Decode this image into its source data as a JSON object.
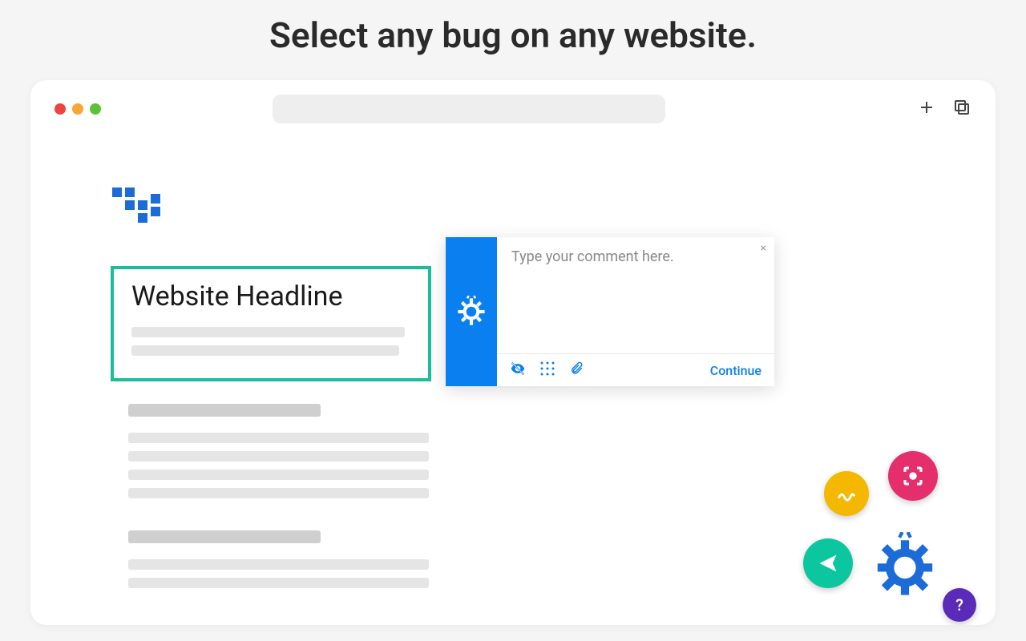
{
  "page": {
    "title": "Select any bug on any website."
  },
  "mockup": {
    "headline": "Website Headline"
  },
  "comment_popup": {
    "placeholder": "Type your comment here.",
    "continue_label": "Continue"
  },
  "colors": {
    "primary_blue": "#0a7ff0",
    "highlight_teal": "#1abc9c",
    "fab_yellow": "#f5b800",
    "fab_pink": "#e52f6c",
    "fab_teal": "#0cc6a0",
    "fab_purple": "#5a2ab8"
  },
  "icons": {
    "plus": "plus-icon",
    "copy": "copy-icon",
    "bug_gear": "bug-gear-icon",
    "visibility_off": "visibility-off-icon",
    "grid": "grid-icon",
    "attachment": "attachment-icon",
    "draw": "draw-icon",
    "capture": "capture-icon",
    "send": "send-icon",
    "help": "help-icon"
  },
  "help_label": "?"
}
